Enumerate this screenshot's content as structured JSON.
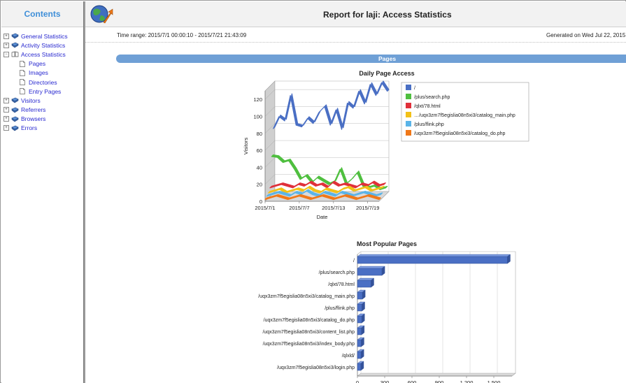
{
  "sidebar": {
    "title": "Contents",
    "items": [
      {
        "label": "General Statistics",
        "level": 0,
        "expanded": false
      },
      {
        "label": "Activity Statistics",
        "level": 0,
        "expanded": false
      },
      {
        "label": "Access Statistics",
        "level": 0,
        "expanded": true
      },
      {
        "label": "Pages",
        "level": 1
      },
      {
        "label": "Images",
        "level": 1
      },
      {
        "label": "Directories",
        "level": 1
      },
      {
        "label": "Entry Pages",
        "level": 1
      },
      {
        "label": "Visitors",
        "level": 0,
        "expanded": false
      },
      {
        "label": "Referrers",
        "level": 0,
        "expanded": false
      },
      {
        "label": "Browsers",
        "level": 0,
        "expanded": false
      },
      {
        "label": "Errors",
        "level": 0,
        "expanded": false
      }
    ]
  },
  "header": {
    "title": "Report for laji: Access Statistics",
    "time_range": "Time range: 2015/7/1 00:00:10 - 2015/7/21 21:43:09",
    "generated": "Generated on Wed Jul 22, 2015"
  },
  "section_title": "Pages",
  "chart_data": [
    {
      "type": "line",
      "title": "Daily Page Access",
      "xlabel": "Date",
      "ylabel": "Visitors",
      "x_ticks": [
        "2015/7/1",
        "2015/7/7",
        "2015/7/13",
        "2015/7/19"
      ],
      "y_ticks": [
        0,
        20,
        40,
        60,
        80,
        100,
        120
      ],
      "ylim": [
        0,
        130
      ],
      "legend_position": "right",
      "series": [
        {
          "name": "/",
          "color": "#4a6fc4",
          "values": [
            76,
            90,
            85,
            115,
            80,
            78,
            88,
            82,
            95,
            102,
            80,
            98,
            75,
            106,
            100,
            120,
            105,
            128,
            115,
            130,
            120
          ]
        },
        {
          "name": "/plus/search.php",
          "color": "#4fbf3f",
          "values": [
            45,
            44,
            38,
            40,
            30,
            18,
            22,
            14,
            20,
            16,
            12,
            15,
            30,
            12,
            18,
            26,
            10,
            8,
            10,
            6,
            8
          ]
        },
        {
          "name": "/qlxt/78.html",
          "color": "#e0303a",
          "values": [
            10,
            12,
            14,
            12,
            10,
            14,
            12,
            16,
            12,
            14,
            10,
            16,
            12,
            14,
            12,
            10,
            14,
            12,
            16,
            12,
            14
          ]
        },
        {
          "name": "…/uqx3zm7f5egislia08n5xi3/catalog_main.php",
          "color": "#f2c118",
          "values": [
            6,
            8,
            10,
            6,
            8,
            10,
            8,
            12,
            8,
            6,
            10,
            8,
            6,
            10,
            12,
            8,
            10,
            12,
            8,
            10,
            12
          ]
        },
        {
          "name": "/plus/flink.php",
          "color": "#5ab4e8",
          "values": [
            4,
            6,
            8,
            6,
            4,
            8,
            6,
            10,
            6,
            4,
            8,
            6,
            4,
            8,
            6,
            4,
            6,
            8,
            6,
            4,
            6
          ]
        },
        {
          "name": "/uqx3zm7f5egislia08n5xi3/catalog_do.php",
          "color": "#f07818",
          "values": [
            2,
            4,
            6,
            4,
            2,
            4,
            6,
            4,
            2,
            4,
            6,
            4,
            2,
            4,
            6,
            4,
            2,
            4,
            6,
            4,
            2
          ]
        }
      ]
    },
    {
      "type": "bar",
      "orientation": "horizontal",
      "title": "Most Popular Pages",
      "x_ticks": [
        "0",
        "300",
        "600",
        "900",
        "1,200",
        "1,500"
      ],
      "xlim": [
        0,
        1700
      ],
      "categories": [
        "/",
        "/plus/search.php",
        "/qlxt/78.html",
        "/uqx3zm7f5egislia08n5xi3/catalog_main.php",
        "/plus/flink.php",
        "/uqx3zm7f5egislia08n5xi3/catalog_do.php",
        "/uqx3zm7f5egislia08n5xi3/content_list.php",
        "/uqx3zm7f5egislia08n5xi3/index_body.php",
        "/qlxld/",
        "/uqx3zm7f5egislia08n5xi3/login.php"
      ],
      "values": [
        1650,
        270,
        150,
        55,
        50,
        48,
        45,
        42,
        40,
        38
      ],
      "color": "#4a6fc4"
    }
  ]
}
